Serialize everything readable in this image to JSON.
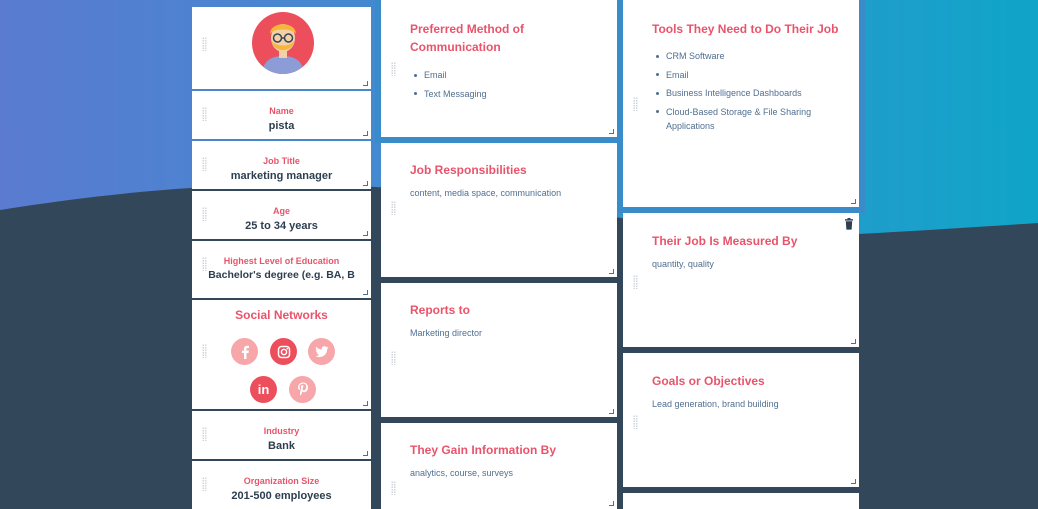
{
  "profile": {
    "fields": [
      {
        "label": "Name",
        "value": "pista"
      },
      {
        "label": "Job Title",
        "value": "marketing manager"
      },
      {
        "label": "Age",
        "value": "25 to 34 years"
      },
      {
        "label": "Highest Level of Education",
        "value": "Bachelor's degree (e.g. BA, B"
      },
      {
        "label": "Industry",
        "value": "Bank"
      },
      {
        "label": "Organization Size",
        "value": "201-500 employees"
      }
    ],
    "social": {
      "title": "Social Networks",
      "networks": [
        {
          "name": "facebook",
          "active": false
        },
        {
          "name": "instagram",
          "active": true
        },
        {
          "name": "twitter",
          "active": false
        },
        {
          "name": "linkedin",
          "active": true
        },
        {
          "name": "pinterest",
          "active": false
        }
      ]
    }
  },
  "sections": {
    "communication": {
      "title": "Preferred Method of Communication",
      "items": [
        "Email",
        "Text Messaging"
      ]
    },
    "responsibilities": {
      "title": "Job Responsibilities",
      "text": "content, media space, communication"
    },
    "reports_to": {
      "title": "Reports to",
      "text": "Marketing director"
    },
    "gain_info": {
      "title": "They Gain Information By",
      "text": "analytics, course, surveys"
    },
    "tools": {
      "title": "Tools They Need to Do Their Job",
      "items": [
        "CRM Software",
        "Email",
        "Business Intelligence Dashboards",
        "Cloud-Based Storage & File Sharing Applications"
      ]
    },
    "measured_by": {
      "title": "Their Job Is Measured By",
      "text": "quantity, quality"
    },
    "goals": {
      "title": "Goals or Objectives",
      "text": "Lead generation, brand building"
    }
  },
  "colors": {
    "accent": "#e9546b",
    "text_dark": "#2d3e50",
    "text_body": "#516f90",
    "background_dark": "#33475b",
    "highlight_blue": "#3a8bc9"
  }
}
